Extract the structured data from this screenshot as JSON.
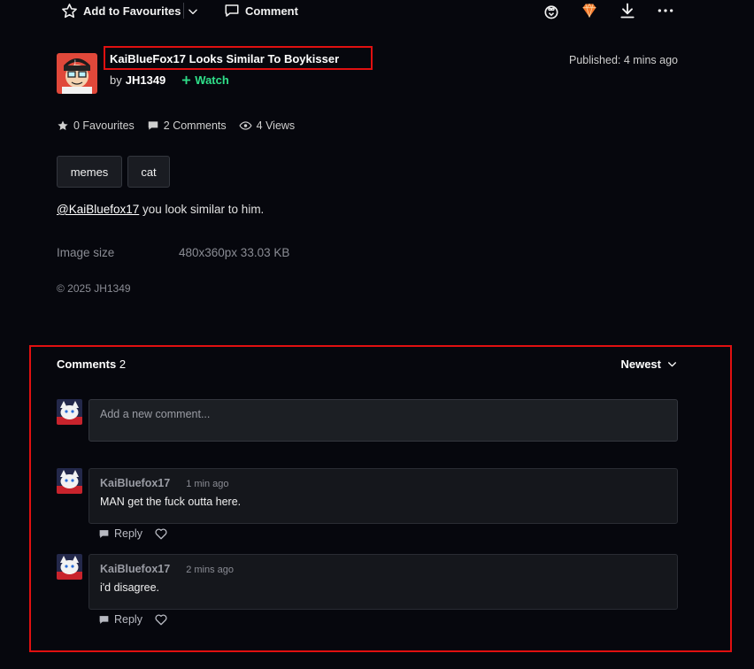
{
  "toolbar": {
    "add_favourites_label": "Add to Favourites",
    "comment_label": "Comment",
    "icons": [
      "star-outline-icon",
      "chevron-down-icon",
      "comment-icon",
      "gift-icon",
      "core-gem-icon",
      "download-icon",
      "more-options-icon"
    ]
  },
  "deviation": {
    "title": "KaiBlueFox17 Looks Similar To Boykisser",
    "by_label": "by",
    "author": "JH1349",
    "watch_label": "Watch",
    "published": "Published: 4 mins ago"
  },
  "stats": {
    "favourites": "0 Favourites",
    "comments": "2 Comments",
    "views": "4 Views"
  },
  "tags": [
    "memes",
    "cat"
  ],
  "description": {
    "mention": "@KaiBluefox17",
    "text": " you look similar to him."
  },
  "details": {
    "image_size_label": "Image size",
    "image_size_value": "480x360px 33.03 KB",
    "copyright": "© 2025 JH1349"
  },
  "comments": {
    "heading": "Comments",
    "count": "2",
    "sort_label": "Newest",
    "input_placeholder": "Add a new comment...",
    "items": [
      {
        "user": "KaiBluefox17",
        "time": "1 min ago",
        "text": "MAN get the fuck outta here.",
        "reply_label": "Reply"
      },
      {
        "user": "KaiBluefox17",
        "time": "2 mins ago",
        "text": "i'd disagree.",
        "reply_label": "Reply"
      }
    ]
  },
  "colors": {
    "background": "#06070d",
    "highlight_border": "#e01010",
    "watch_green": "#2fe08a",
    "core_gem_orange": "#f5782a"
  }
}
